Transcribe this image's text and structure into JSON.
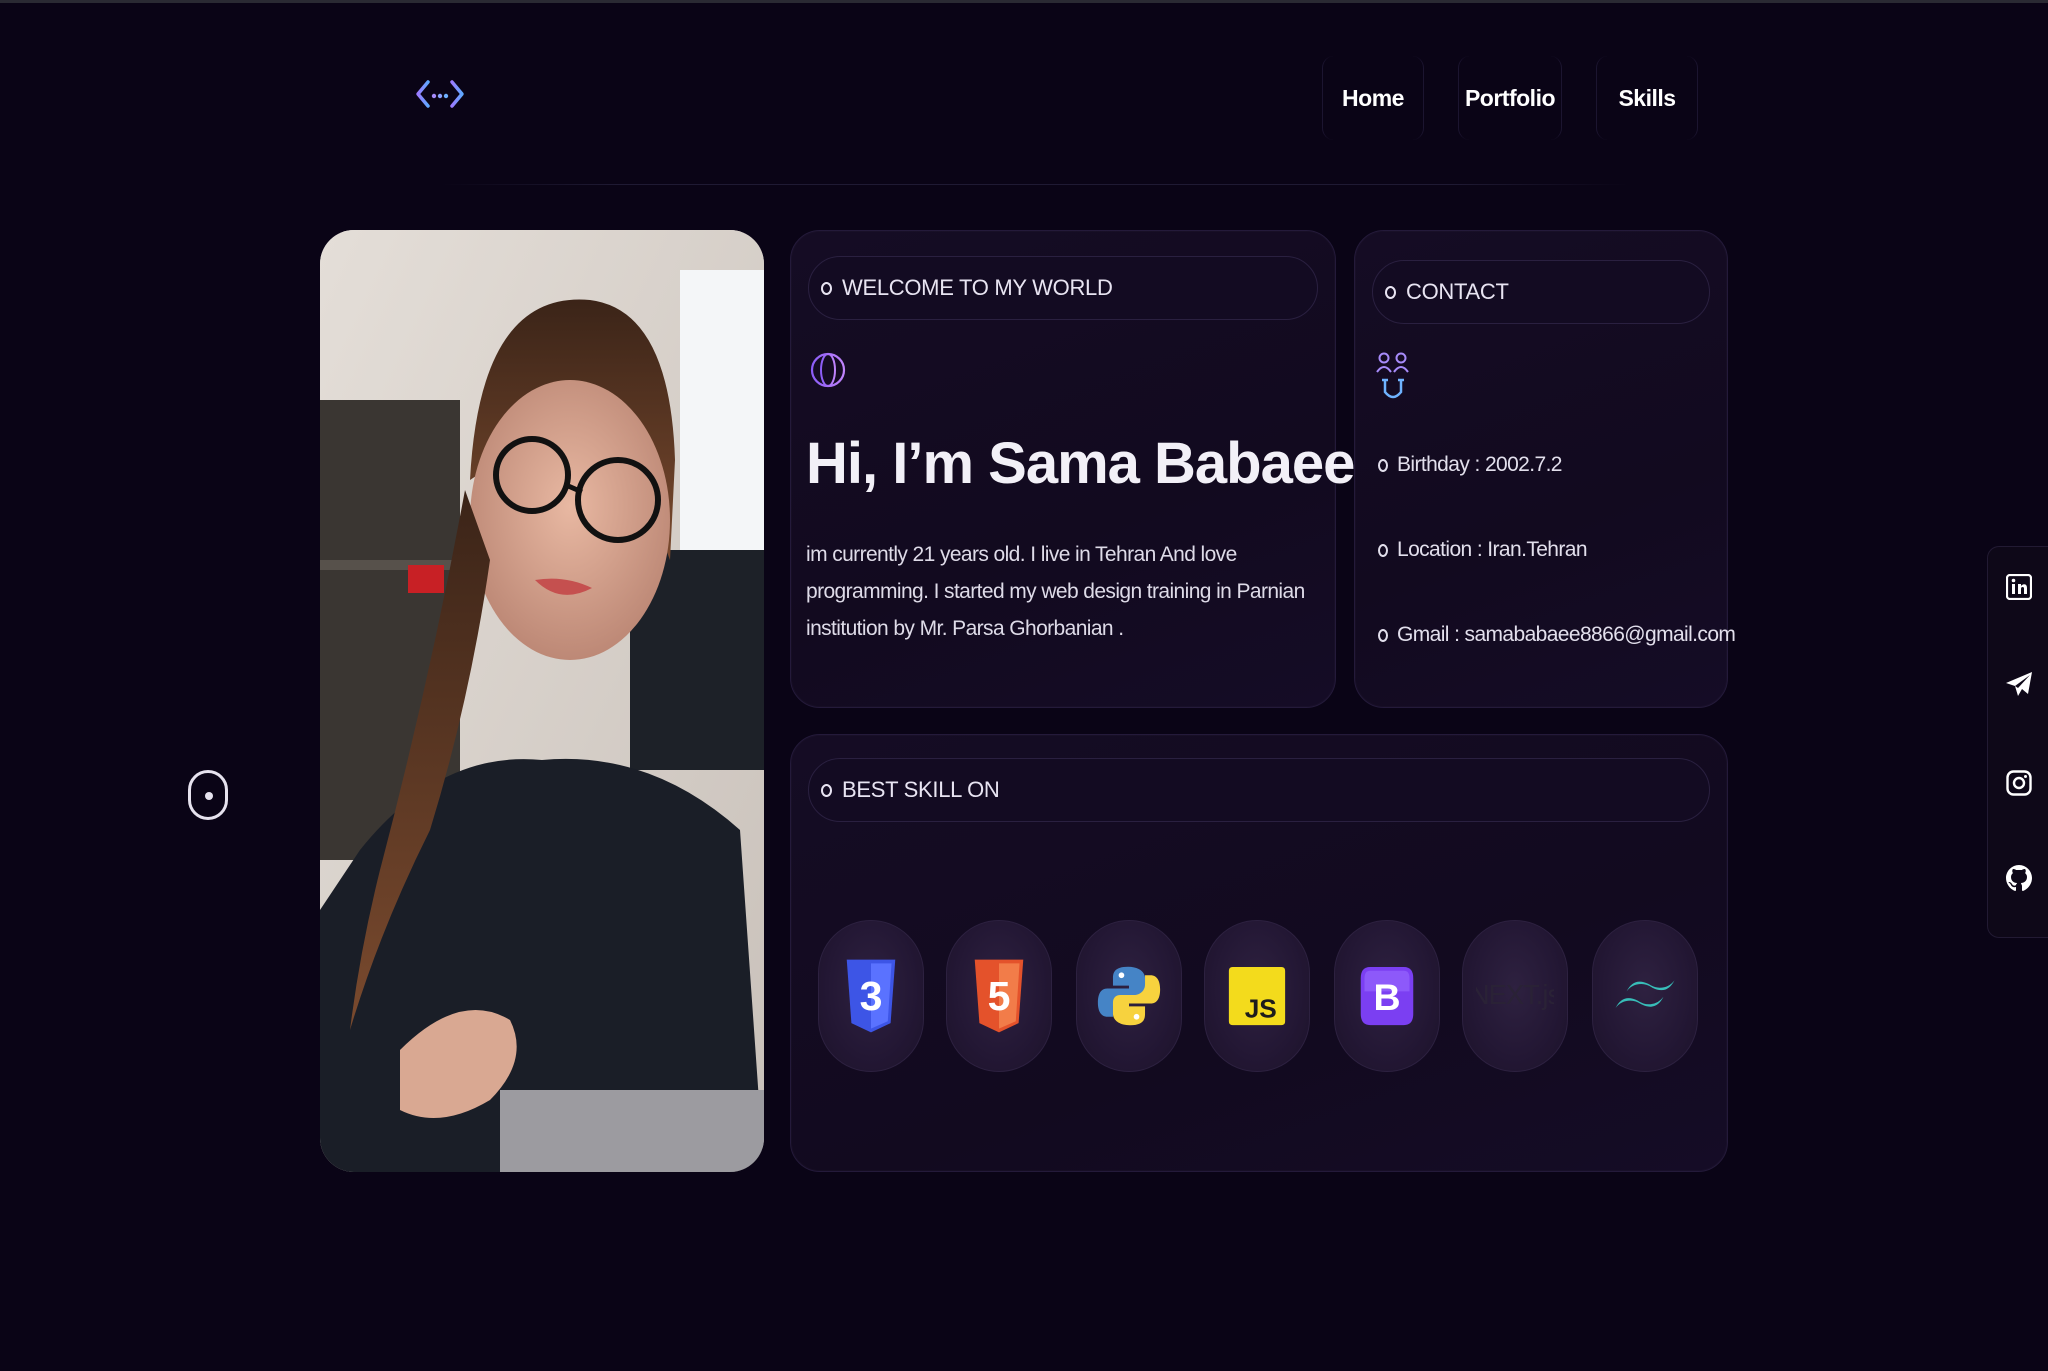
{
  "nav": {
    "items": [
      {
        "label": "Home"
      },
      {
        "label": "Portfolio"
      },
      {
        "label": "Skills"
      }
    ]
  },
  "welcome": {
    "pill_label": "WELCOME TO MY WORLD",
    "title": "Hi, I’m Sama Babaee",
    "bio": "im currently 21 years old. I live in Tehran And love programming. I started my web design training in Parnian institution by Mr. Parsa Ghorbanian ."
  },
  "contact": {
    "pill_label": "CONTACT",
    "lines": [
      {
        "text": "Birthday : 2002.7.2"
      },
      {
        "text": "Location : Iran.Tehran"
      },
      {
        "text": "Gmail : samababaee8866@gmail.com"
      }
    ]
  },
  "skills": {
    "pill_label": "BEST SKILL ON",
    "items": [
      {
        "icon": "css3-icon",
        "label": "3",
        "color": "#3d55e6"
      },
      {
        "icon": "html5-icon",
        "label": "5",
        "color": "#ef6a3a"
      },
      {
        "icon": "python-icon",
        "label": "",
        "color": "#4584c6"
      },
      {
        "icon": "javascript-icon",
        "label": "JS",
        "color": "#f3db1c"
      },
      {
        "icon": "bootstrap-icon",
        "label": "B",
        "color": "#7b3ff2"
      },
      {
        "icon": "nextjs-icon",
        "label": "NEXT.js",
        "color": "#2a2236"
      },
      {
        "icon": "tailwind-icon",
        "label": "",
        "color": "#38bdb8"
      }
    ]
  },
  "social": [
    {
      "icon": "linkedin-icon"
    },
    {
      "icon": "telegram-icon"
    },
    {
      "icon": "instagram-icon"
    },
    {
      "icon": "github-icon"
    }
  ],
  "colors": {
    "background": "#0a0416",
    "card": "#140b22",
    "accent": "#8b5cf6"
  }
}
